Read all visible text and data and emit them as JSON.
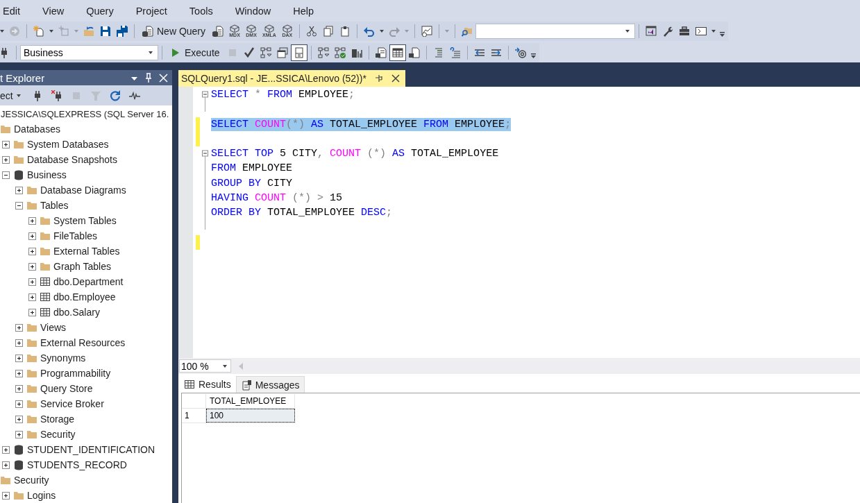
{
  "menu": [
    "Edit",
    "View",
    "Query",
    "Project",
    "Tools",
    "Window",
    "Help"
  ],
  "toolbars": [
    {
      "items": [
        {
          "kind": "caret",
          "disabled": false,
          "pressed": false
        },
        {
          "kind": "forward",
          "disabled": true,
          "pressed": false
        },
        {
          "kind": "sep"
        },
        {
          "kind": "new-project",
          "disabled": false,
          "pressed": false
        },
        {
          "kind": "caret",
          "disabled": false,
          "pressed": false
        },
        {
          "kind": "add-item",
          "disabled": true,
          "pressed": false
        },
        {
          "kind": "caret",
          "disabled": true,
          "pressed": false
        },
        {
          "kind": "open",
          "disabled": false,
          "pressed": false
        },
        {
          "kind": "save",
          "disabled": false,
          "pressed": false
        },
        {
          "kind": "save-all",
          "disabled": false,
          "pressed": false
        },
        {
          "kind": "sep"
        },
        {
          "kind": "new-query",
          "label": "New Query",
          "disabled": false,
          "pressed": false
        },
        {
          "kind": "db-query",
          "disabled": false,
          "pressed": false
        },
        {
          "kind": "cube",
          "label": "MDX",
          "disabled": false,
          "pressed": false
        },
        {
          "kind": "cube",
          "label": "DMX",
          "disabled": false,
          "pressed": false
        },
        {
          "kind": "cube",
          "label": "XMLA",
          "disabled": false,
          "pressed": false
        },
        {
          "kind": "cube",
          "label": "DAX",
          "disabled": false,
          "pressed": false
        },
        {
          "kind": "sep"
        },
        {
          "kind": "cut",
          "disabled": false,
          "pressed": false
        },
        {
          "kind": "copy",
          "disabled": false,
          "pressed": false
        },
        {
          "kind": "paste",
          "disabled": false,
          "pressed": false
        },
        {
          "kind": "sep"
        },
        {
          "kind": "undo",
          "disabled": false,
          "pressed": false
        },
        {
          "kind": "caret",
          "disabled": false,
          "pressed": false
        },
        {
          "kind": "redo",
          "disabled": true,
          "pressed": false
        },
        {
          "kind": "caret",
          "disabled": true,
          "pressed": false
        },
        {
          "kind": "sep"
        },
        {
          "kind": "activity",
          "disabled": false,
          "pressed": false
        },
        {
          "kind": "sep"
        },
        {
          "kind": "caret",
          "disabled": true,
          "pressed": false
        },
        {
          "kind": "sep"
        },
        {
          "kind": "find-folder",
          "disabled": false,
          "pressed": false
        },
        {
          "kind": "search-combo"
        },
        {
          "kind": "sep"
        },
        {
          "kind": "vs",
          "disabled": false,
          "pressed": false
        },
        {
          "kind": "wrench",
          "disabled": false,
          "pressed": false
        },
        {
          "kind": "toolbox",
          "disabled": false,
          "pressed": false
        },
        {
          "kind": "terminal",
          "disabled": false,
          "pressed": false
        },
        {
          "kind": "caret",
          "disabled": false,
          "pressed": false
        },
        {
          "kind": "overflow",
          "disabled": false,
          "pressed": false
        }
      ]
    },
    {
      "items": [
        {
          "kind": "plug",
          "disabled": false,
          "pressed": false
        },
        {
          "kind": "sep"
        },
        {
          "kind": "database-combo",
          "value": "Business"
        },
        {
          "kind": "sep"
        },
        {
          "kind": "execute",
          "label": "Execute",
          "disabled": false,
          "pressed": false
        },
        {
          "kind": "stop",
          "disabled": true,
          "pressed": false
        },
        {
          "kind": "check",
          "disabled": false,
          "pressed": false
        },
        {
          "kind": "plan",
          "disabled": false,
          "pressed": false
        },
        {
          "kind": "windows",
          "disabled": false,
          "pressed": false
        },
        {
          "kind": "pane",
          "disabled": false,
          "pressed": true
        },
        {
          "kind": "sep"
        },
        {
          "kind": "plan",
          "disabled": false,
          "pressed": false
        },
        {
          "kind": "plan-check",
          "disabled": false,
          "pressed": false
        },
        {
          "kind": "stats",
          "disabled": false,
          "pressed": false
        },
        {
          "kind": "sep"
        },
        {
          "kind": "text-result",
          "disabled": false,
          "pressed": false
        },
        {
          "kind": "grid-result",
          "disabled": false,
          "pressed": true
        },
        {
          "kind": "file-result",
          "disabled": false,
          "pressed": false
        },
        {
          "kind": "sep"
        },
        {
          "kind": "comment",
          "disabled": false,
          "pressed": false
        },
        {
          "kind": "uncomment",
          "disabled": false,
          "pressed": false
        },
        {
          "kind": "sep"
        },
        {
          "kind": "outdent",
          "disabled": false,
          "pressed": false
        },
        {
          "kind": "indent",
          "disabled": false,
          "pressed": false
        },
        {
          "kind": "sep"
        },
        {
          "kind": "template",
          "disabled": false,
          "pressed": false
        },
        {
          "kind": "overflow",
          "disabled": false,
          "pressed": false
        }
      ]
    }
  ],
  "object_explorer": {
    "title": "t Explorer",
    "toolbar": [
      {
        "kind": "connect",
        "label": "ect",
        "disabled": false,
        "pressed": false
      },
      {
        "kind": "plug",
        "disabled": false,
        "pressed": false
      },
      {
        "kind": "plug-x",
        "disabled": false,
        "pressed": false
      },
      {
        "kind": "stop",
        "disabled": true,
        "pressed": false
      },
      {
        "kind": "filter",
        "disabled": true,
        "pressed": false
      },
      {
        "kind": "refresh",
        "disabled": false,
        "pressed": false
      },
      {
        "kind": "wave",
        "disabled": false,
        "pressed": false
      }
    ],
    "tree": [
      {
        "label": "JESSICA\\SQLEXPRESS (SQL Server 16.",
        "kind": "server",
        "expanded": true,
        "children": [
          {
            "label": "Databases",
            "kind": "folder",
            "expanded": true,
            "children": [
              {
                "label": "System Databases",
                "kind": "folder",
                "expanded": false
              },
              {
                "label": "Database Snapshots",
                "kind": "folder",
                "expanded": false
              },
              {
                "label": "Business",
                "kind": "database",
                "expanded": true,
                "children": [
                  {
                    "label": "Database Diagrams",
                    "kind": "folder",
                    "expanded": false
                  },
                  {
                    "label": "Tables",
                    "kind": "folder",
                    "expanded": true,
                    "children": [
                      {
                        "label": "System Tables",
                        "kind": "folder",
                        "expanded": false
                      },
                      {
                        "label": "FileTables",
                        "kind": "folder",
                        "expanded": false
                      },
                      {
                        "label": "External Tables",
                        "kind": "folder",
                        "expanded": false
                      },
                      {
                        "label": "Graph Tables",
                        "kind": "folder",
                        "expanded": false
                      },
                      {
                        "label": "dbo.Department",
                        "kind": "table",
                        "expanded": false
                      },
                      {
                        "label": "dbo.Employee",
                        "kind": "table",
                        "expanded": false
                      },
                      {
                        "label": "dbo.Salary",
                        "kind": "table",
                        "expanded": false
                      }
                    ]
                  },
                  {
                    "label": "Views",
                    "kind": "folder",
                    "expanded": false
                  },
                  {
                    "label": "External Resources",
                    "kind": "folder",
                    "expanded": false
                  },
                  {
                    "label": "Synonyms",
                    "kind": "folder",
                    "expanded": false
                  },
                  {
                    "label": "Programmability",
                    "kind": "folder",
                    "expanded": false
                  },
                  {
                    "label": "Query Store",
                    "kind": "folder",
                    "expanded": false
                  },
                  {
                    "label": "Service Broker",
                    "kind": "folder",
                    "expanded": false
                  },
                  {
                    "label": "Storage",
                    "kind": "folder",
                    "expanded": false
                  },
                  {
                    "label": "Security",
                    "kind": "folder",
                    "expanded": false
                  }
                ]
              },
              {
                "label": "STUDENT_IDENTIFICATION",
                "kind": "database",
                "expanded": false
              },
              {
                "label": "STUDENTS_RECORD",
                "kind": "database",
                "expanded": false
              }
            ]
          },
          {
            "label": "Security",
            "kind": "folder",
            "expanded": true,
            "children": [
              {
                "label": "Logins",
                "kind": "folder",
                "expanded": false
              }
            ]
          }
        ]
      }
    ]
  },
  "editor": {
    "tab": {
      "label": "SQLQuery1.sql - JE...SSICA\\Lenovo (52))*",
      "selected": true
    },
    "lines": [
      {
        "collapsible": true,
        "selected": false,
        "changed": false,
        "tokens": [
          {
            "kind": "keyword",
            "text": "SELECT "
          },
          {
            "kind": "operator",
            "text": "* "
          },
          {
            "kind": "keyword",
            "text": "FROM "
          },
          {
            "kind": "plain",
            "text": "EMPLOYEE"
          },
          {
            "kind": "operator",
            "text": ";"
          }
        ]
      },
      {
        "collapsible": false,
        "selected": false,
        "changed": false
      },
      {
        "collapsible": false,
        "selected": true,
        "changed": true,
        "tokens": [
          {
            "kind": "keyword",
            "text": "SELECT "
          },
          {
            "kind": "function",
            "text": "COUNT"
          },
          {
            "kind": "operator",
            "text": "(*) "
          },
          {
            "kind": "keyword",
            "text": "AS "
          },
          {
            "kind": "plain",
            "text": "TOTAL_EMPLOYEE "
          },
          {
            "kind": "keyword",
            "text": "FROM "
          },
          {
            "kind": "plain",
            "text": "EMPLOYEE"
          },
          {
            "kind": "operator",
            "text": ";"
          }
        ]
      },
      {
        "collapsible": false,
        "selected": false,
        "changed": true
      },
      {
        "collapsible": true,
        "selected": false,
        "changed": false,
        "tokens": [
          {
            "kind": "keyword",
            "text": "SELECT TOP "
          },
          {
            "kind": "plain",
            "text": "5 CITY"
          },
          {
            "kind": "operator",
            "text": ", "
          },
          {
            "kind": "function",
            "text": "COUNT "
          },
          {
            "kind": "operator",
            "text": "(*) "
          },
          {
            "kind": "keyword",
            "text": "AS "
          },
          {
            "kind": "plain",
            "text": "TOTAL_EMPLOYEE"
          }
        ]
      },
      {
        "collapsible": false,
        "selected": false,
        "changed": false,
        "tokens": [
          {
            "kind": "keyword",
            "text": "FROM "
          },
          {
            "kind": "plain",
            "text": "EMPLOYEE"
          }
        ]
      },
      {
        "collapsible": false,
        "selected": false,
        "changed": false,
        "tokens": [
          {
            "kind": "keyword",
            "text": "GROUP BY "
          },
          {
            "kind": "plain",
            "text": "CITY"
          }
        ]
      },
      {
        "collapsible": false,
        "selected": false,
        "changed": false,
        "tokens": [
          {
            "kind": "keyword",
            "text": "HAVING "
          },
          {
            "kind": "function",
            "text": "COUNT "
          },
          {
            "kind": "operator",
            "text": "(*) > "
          },
          {
            "kind": "plain",
            "text": "15"
          }
        ]
      },
      {
        "collapsible": false,
        "selected": false,
        "changed": false,
        "tokens": [
          {
            "kind": "keyword",
            "text": "ORDER BY "
          },
          {
            "kind": "plain",
            "text": "TOTAL_EMPLOYEE "
          },
          {
            "kind": "keyword",
            "text": "DESC"
          },
          {
            "kind": "operator",
            "text": ";"
          }
        ]
      },
      {
        "collapsible": false,
        "selected": false,
        "changed": false
      },
      {
        "collapsible": false,
        "selected": false,
        "changed": true
      }
    ]
  },
  "results": {
    "zoom": "100 %",
    "tabs": [
      {
        "label": "Results",
        "kind": "grid",
        "selected": true
      },
      {
        "label": "Messages",
        "kind": "messages",
        "selected": false
      }
    ],
    "grid": {
      "columns": [
        "TOTAL_EMPLOYEE"
      ],
      "rows": [
        {
          "number": "1",
          "cells": [
            "100"
          ],
          "selected": true
        }
      ]
    }
  }
}
